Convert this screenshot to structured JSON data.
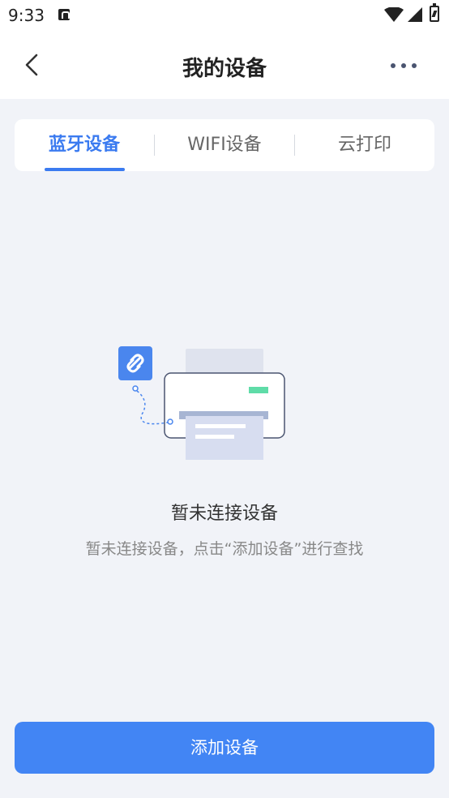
{
  "status_bar": {
    "time": "9:33"
  },
  "header": {
    "title": "我的设备"
  },
  "tabs": [
    {
      "label": "蓝牙设备",
      "active": true
    },
    {
      "label": "WIFI设备",
      "active": false
    },
    {
      "label": "云打印",
      "active": false
    }
  ],
  "empty_state": {
    "title": "暂未连接设备",
    "description": "暂未连接设备，点击“添加设备”进行查找"
  },
  "primary_action": {
    "label": "添加设备"
  },
  "colors": {
    "accent": "#3b7bf0",
    "button": "#4285f4",
    "background": "#f1f3f8"
  }
}
